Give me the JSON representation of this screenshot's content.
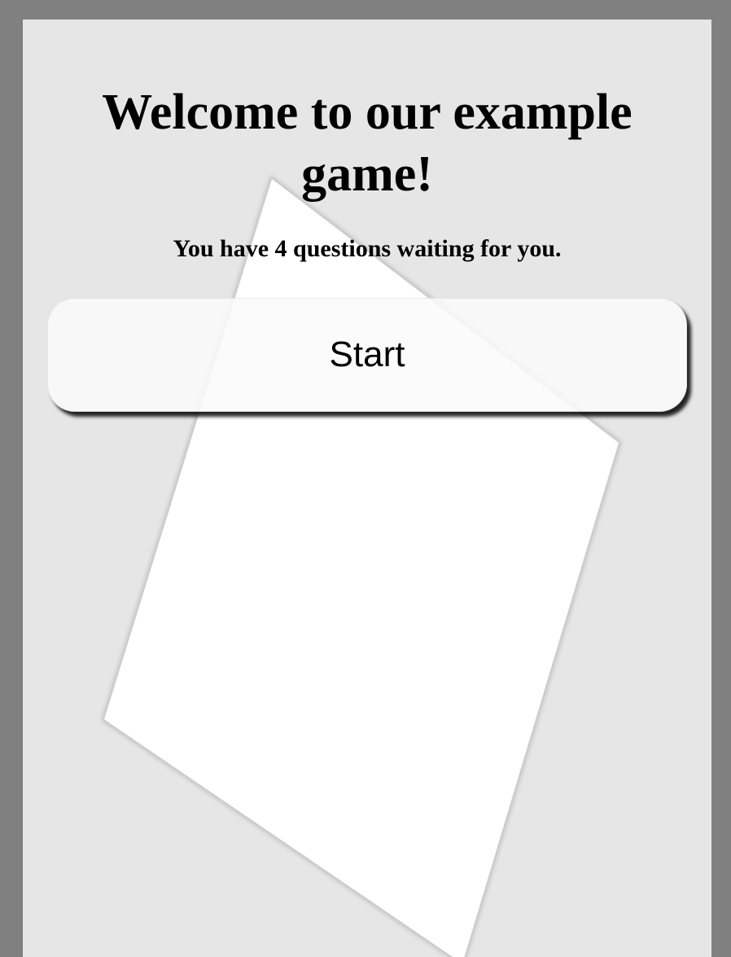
{
  "game": {
    "title": "Welcome to our example game!",
    "subtitle": "You have 4 questions waiting for you.",
    "start_label": "Start"
  },
  "colors": {
    "outer_background": "#808080",
    "panel_background": "#e6e6e6",
    "card_fill": "#ffffff",
    "card_edge": "#c8c8c8",
    "button_fill": "#fafafa"
  }
}
